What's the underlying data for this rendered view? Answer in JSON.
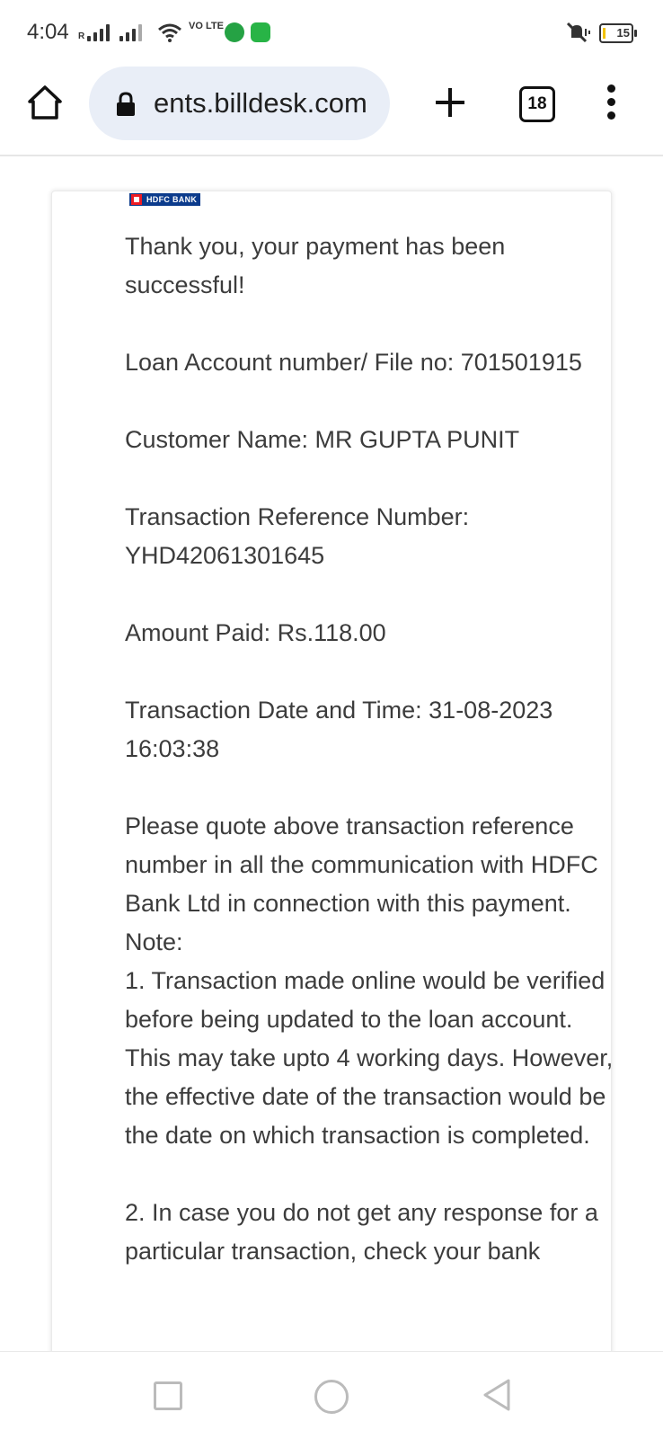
{
  "status_bar": {
    "time": "4:04",
    "sim_label": "R",
    "volte_label": "VO LTE",
    "battery": "15"
  },
  "browser": {
    "url": "ents.billdesk.com",
    "tab_count": "18"
  },
  "page": {
    "bank_name": "HDFC BANK",
    "success_message": "Thank you, your payment has been successful!",
    "loan_account": "Loan Account number/ File no: 701501915",
    "customer_name": "Customer Name: MR GUPTA PUNIT",
    "txn_ref_label": "Transaction Reference Number:",
    "txn_ref_value": "YHD42061301645",
    "amount_paid": "Amount Paid: Rs.118.00",
    "txn_datetime_label": "Transaction Date and Time: 31-08-2023",
    "txn_datetime_time": "16:03:38",
    "quote_notice": "Please quote above transaction reference number in all the communication with HDFC Bank Ltd in connection with this payment.",
    "note_label": "Note:",
    "note_1": "1. Transaction made online would be verified before being updated to the loan account. This may take upto 4 working days. However, the effective date of the transaction would be the date on which transaction is completed.",
    "note_2": "2. In case you do not get any response for a particular transaction, check your bank"
  },
  "colors": {
    "url_pill": "#e9eef7",
    "bank_blue": "#0b3b8c",
    "bank_red": "#ed1c24",
    "text": "#3c3c3c"
  },
  "icons": {
    "home": "home-icon",
    "lock": "lock-icon",
    "new_tab": "plus-icon",
    "menu": "more-vert-icon",
    "nav_recent": "square-icon",
    "nav_home": "circle-icon",
    "nav_back": "triangle-back-icon"
  }
}
